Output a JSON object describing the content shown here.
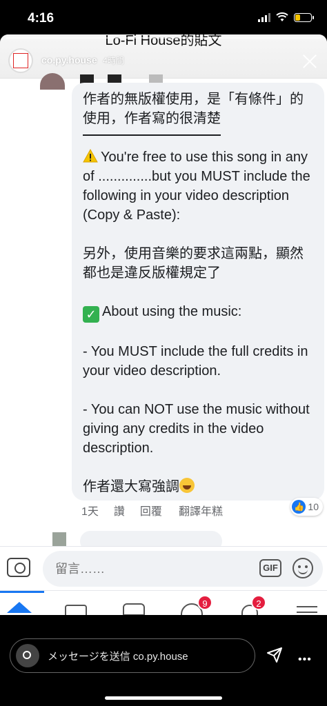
{
  "status_bar": {
    "time": "4:16"
  },
  "story": {
    "username": "co.py.house",
    "age": "4時間",
    "fb_page_title": "Lo-Fi House的貼文"
  },
  "comment": {
    "line1": "作者的無版權使用，是「有條件」的使用，作者寫的很清楚",
    "para2": "You're free to use this song in any of ..............but you MUST include the following in your video description (Copy & Paste):",
    "para3": "另外，使用音樂的要求這兩點，顯然都也是違反版權規定了",
    "para4": "About using the music:",
    "para5": "- You MUST include the full credits in your video description.",
    "para6": "- You can NOT use the music without giving any credits in the video description.",
    "para7": "作者還大寫強調",
    "actions": {
      "time": "1天",
      "like": "讚",
      "reply": "回覆",
      "translate": "翻譯年糕"
    },
    "reaction_count": "10"
  },
  "composer": {
    "placeholder": "留言……",
    "gif_label": "GIF"
  },
  "tabs": {
    "groups_badge": "9",
    "notifications_badge": "2"
  },
  "ig_reply": {
    "placeholder": "メッセージを送信 co.py.house",
    "more": "•••"
  },
  "colors": {
    "fb_blue": "#1877f2",
    "bubble_bg": "#f0f2f5",
    "badge_red": "#e41e3f"
  }
}
